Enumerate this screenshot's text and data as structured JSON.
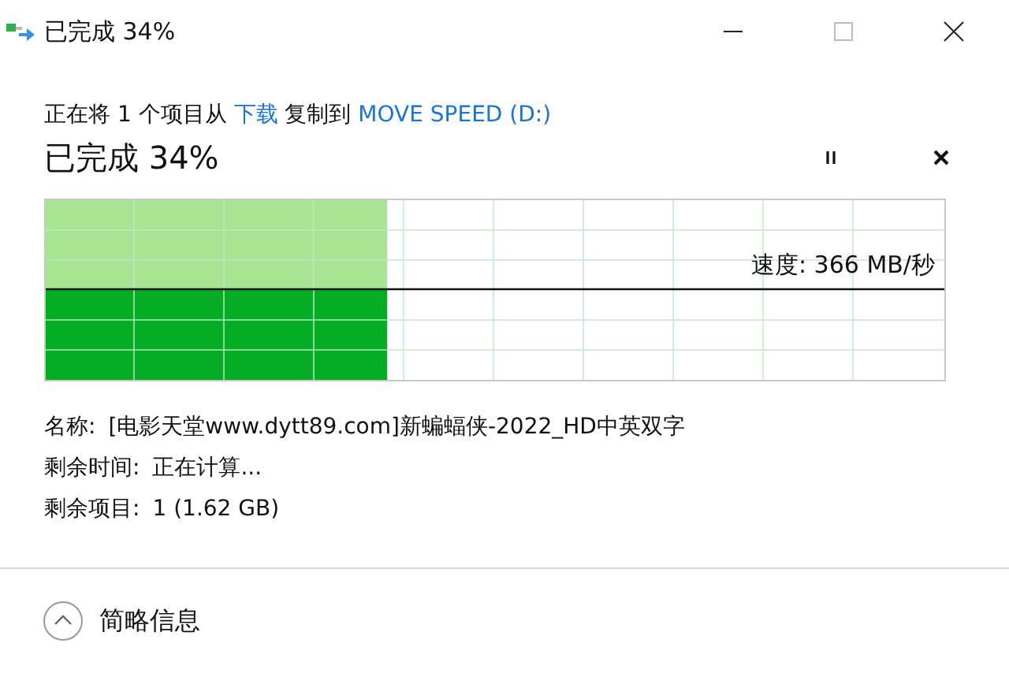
{
  "window": {
    "title": "已完成 34%"
  },
  "copy_line": {
    "prefix": "正在将 1 个项目从",
    "source": "下载",
    "middle": "复制到",
    "destination": "MOVE SPEED (D:)"
  },
  "status": "已完成 34%",
  "progress": {
    "level": 0.38,
    "speed": "速度: 366 MB/秒"
  },
  "details": [
    {
      "label": "名称:",
      "value": "[电影天堂www.dytt89.com]新蝙蝠侠-2022_HD中英双字"
    },
    {
      "label": "剩余时间:",
      "value": "正在计算..."
    },
    {
      "label": "剩余项目:",
      "value": "1 (1.62 GB)"
    }
  ],
  "toggle": {
    "label": "简略信息",
    "expanded": true
  }
}
